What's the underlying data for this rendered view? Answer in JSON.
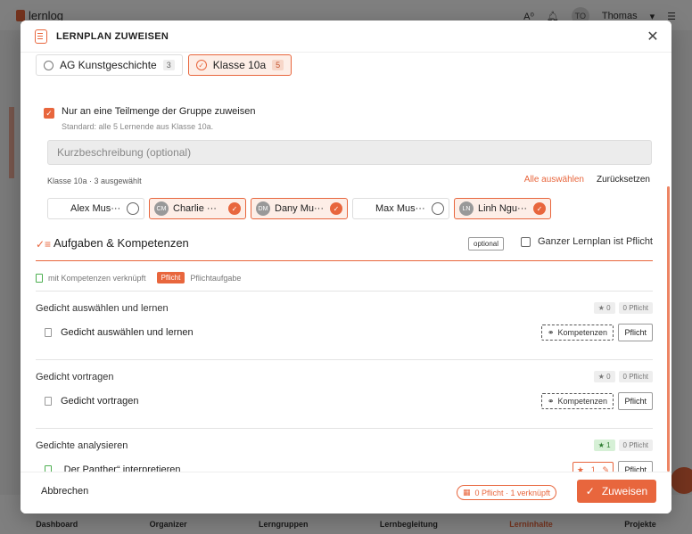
{
  "app": {
    "logo": "lernlog",
    "user": "Thomas",
    "user_initials": "TO",
    "nav": [
      "Dashboard",
      "Organizer",
      "Lerngruppen",
      "Lernbegleitung",
      "Lerninhalte",
      "Projekte"
    ]
  },
  "modal": {
    "title": "LERNPLAN ZUWEISEN",
    "close_glyph": "✕"
  },
  "groups": [
    {
      "name": "AG Kunstgeschichte",
      "count": "3",
      "selected": false
    },
    {
      "name": "Klasse 10a",
      "count": "5",
      "selected": true
    }
  ],
  "subset": {
    "label": "Nur an eine Teilmenge der Gruppe zuweisen",
    "hint": "Standard: alle 5 Lernende aus Klasse 10a."
  },
  "description": {
    "placeholder": "Kurzbeschreibung (optional)"
  },
  "selection": {
    "summary": "Klasse 10a · 3 ausgewählt",
    "select_all": "Alle auswählen",
    "reset": "Zurücksetzen"
  },
  "students": [
    {
      "name": "Alex Mus···",
      "initials": "",
      "selected": false
    },
    {
      "name": "Charlie ···",
      "initials": "CM",
      "selected": true
    },
    {
      "name": "Dany Mu···",
      "initials": "DM",
      "selected": true
    },
    {
      "name": "Max Mus···",
      "initials": "",
      "selected": false
    },
    {
      "name": "Linh Ngu···",
      "initials": "LN",
      "selected": true
    }
  ],
  "tasks": {
    "icon": "✓≡",
    "title": "Aufgaben & Kompetenzen",
    "optional_badge": "optional",
    "whole_plan_label": "Ganzer Lernplan ist Pflicht",
    "legend_linked": "mit Kompetenzen verknüpft",
    "legend_badge": "Pflicht",
    "legend_required": "Pflichtaufgabe"
  },
  "task_groups": [
    {
      "title": "Gedicht auswählen und lernen",
      "stars": "★ 0",
      "required": "0 Pflicht",
      "item": "Gedicht auswählen und lernen",
      "linked": false,
      "komp_label": "Kompetenzen",
      "pflicht_label": "Pflicht"
    },
    {
      "title": "Gedicht vortragen",
      "stars": "★ 0",
      "required": "0 Pflicht",
      "item": "Gedicht vortragen",
      "linked": false,
      "komp_label": "Kompetenzen",
      "pflicht_label": "Pflicht"
    },
    {
      "title": "Gedichte analysieren",
      "stars": "★ 1",
      "required": "0 Pflicht",
      "item": "„Der Panther“ interpretieren",
      "linked": true,
      "star_count": "1",
      "pflicht_label": "Pflicht"
    }
  ],
  "footer": {
    "cancel": "Abbrechen",
    "summary": "0 Pflicht · 1 verknüpft",
    "submit": "Zuweisen"
  },
  "colors": {
    "accent": "#e8663d",
    "accent_light": "#fdeee7",
    "linked_green": "#4caf50"
  }
}
